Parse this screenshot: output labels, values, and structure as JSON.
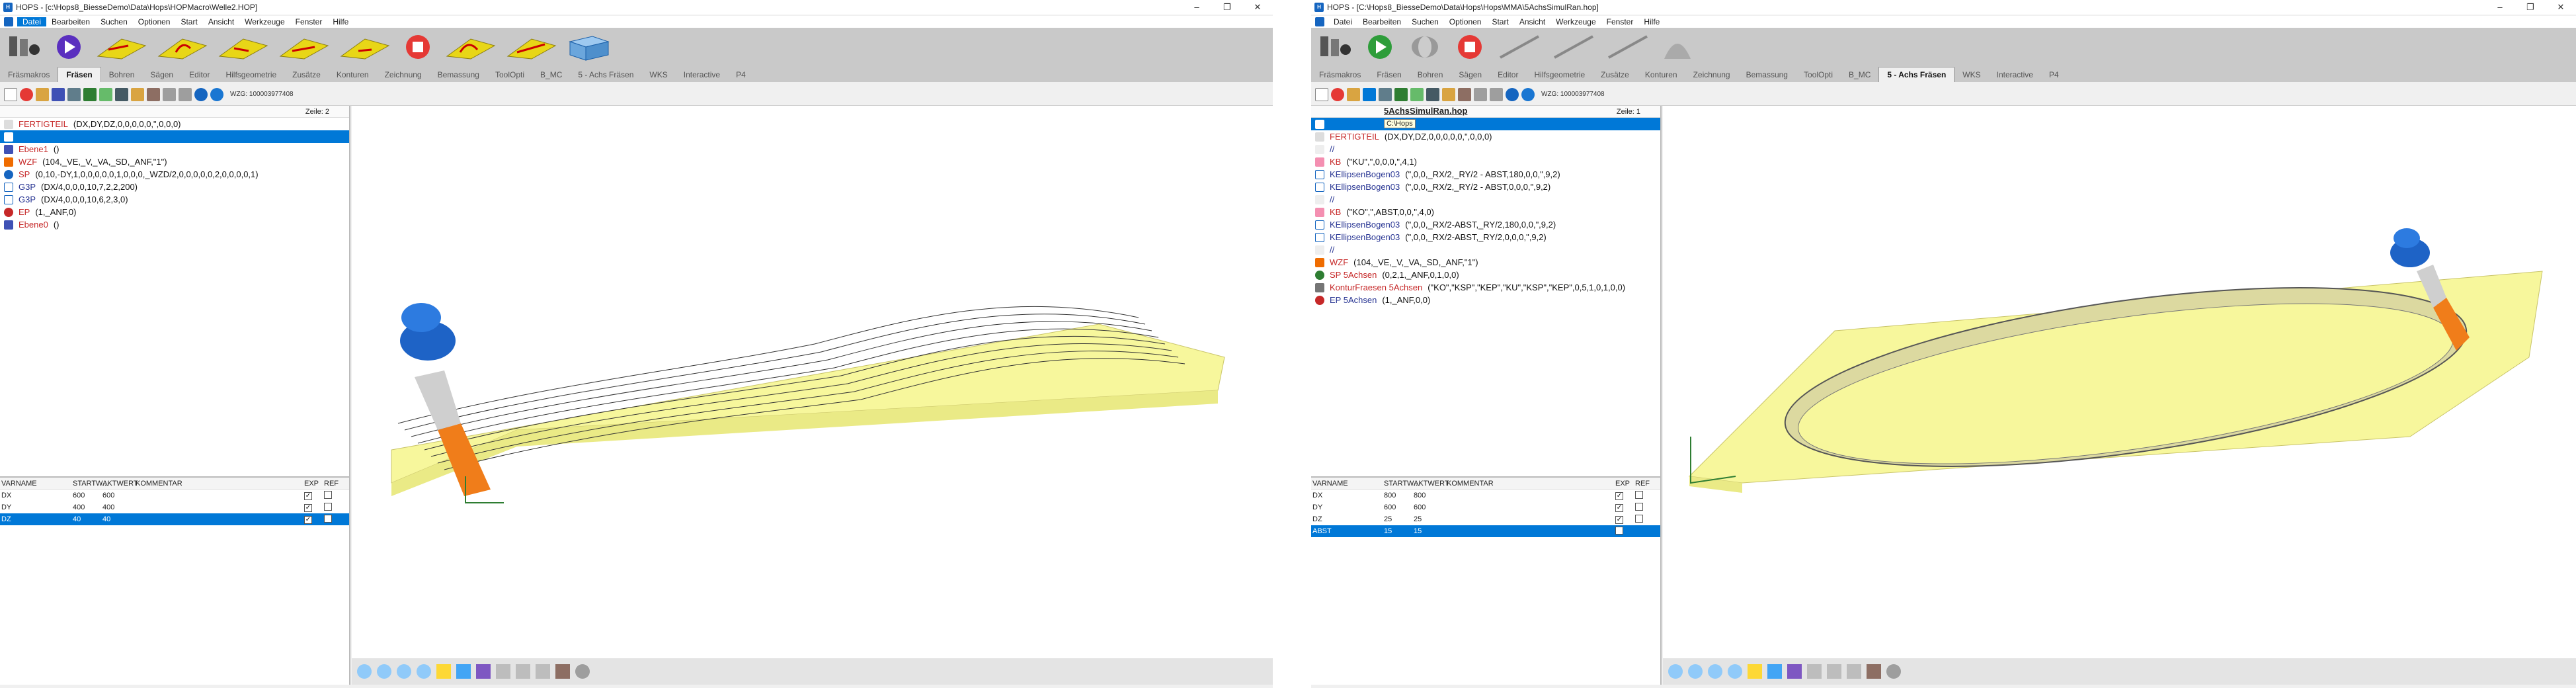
{
  "left": {
    "title": "HOPS - [c:\\Hops8_BiesseDemo\\Data\\Hops\\HOPMacro\\Welle2.HOP]",
    "menu": [
      "Datei",
      "Bearbeiten",
      "Suchen",
      "Optionen",
      "Start",
      "Ansicht",
      "Werkzeuge",
      "Fenster",
      "Hilfe"
    ],
    "tabs": [
      "Fräsmakros",
      "Fräsen",
      "Bohren",
      "Sägen",
      "Editor",
      "Hilfsgeometrie",
      "Zusätze",
      "Konturen",
      "Zeichnung",
      "Bemassung",
      "ToolOpti",
      "B_MC",
      "5 - Achs Fräsen",
      "WKS",
      "Interactive",
      "P4"
    ],
    "active_tab": "Fräsen",
    "wzg": "WZG: 100003977408",
    "zeile": "Zeile: 2",
    "program": [
      {
        "kw": "FERTIGTEIL",
        "args": "(DX,DY,DZ,0,0,0,0,0,\",0,0,0)"
      },
      {
        "kw": "",
        "args": ""
      },
      {
        "kw": "Ebene1",
        "args": "()"
      },
      {
        "kw": "WZF",
        "args": "(104,_VE,_V,_VA,_SD,_ANF,\"1\")"
      },
      {
        "kw": "SP",
        "args": "(0,10,-DY,1,0,0,0,0,0,1,0,0,0,_WZD/2,0,0,0,0,0,2,0,0,0,0,1)"
      },
      {
        "kw": "G3P",
        "args": "(DX/4,0,0,0,10,7,2,2,200)"
      },
      {
        "kw": "G3P",
        "args": "(DX/4,0,0,0,10,6,2,3,0)"
      },
      {
        "kw": "EP",
        "args": "(1,_ANF,0)"
      },
      {
        "kw": "Ebene0",
        "args": "()"
      }
    ],
    "vars_header": [
      "VARNAME",
      "STARTW...",
      "AKTWERT",
      "KOMMENTAR",
      "EXP",
      "REF"
    ],
    "vars": [
      {
        "name": "DX",
        "start": "600",
        "akt": "600",
        "exp": true,
        "ref": false
      },
      {
        "name": "DY",
        "start": "400",
        "akt": "400",
        "exp": true,
        "ref": false
      },
      {
        "name": "DZ",
        "start": "40",
        "akt": "40",
        "exp": true,
        "ref": false
      }
    ]
  },
  "right": {
    "title": "HOPS - [C:\\Hops8_BiesseDemo\\Data\\Hops\\Hops\\MMA\\5AchsSimulRan.hop]",
    "menu": [
      "Datei",
      "Bearbeiten",
      "Suchen",
      "Optionen",
      "Start",
      "Ansicht",
      "Werkzeuge",
      "Fenster",
      "Hilfe"
    ],
    "tabs": [
      "Fräsmakros",
      "Fräsen",
      "Bohren",
      "Sägen",
      "Editor",
      "Hilfsgeometrie",
      "Zusätze",
      "Konturen",
      "Zeichnung",
      "Bemassung",
      "ToolOpti",
      "B_MC",
      "5 - Achs Fräsen",
      "WKS",
      "Interactive",
      "P4"
    ],
    "active_tab": "5 - Achs Fräsen",
    "wzg": "WZG: 100003977408",
    "filename": "5AchsSimulRan.hop",
    "tooltip": "C:\\Hops",
    "zeile": "Zeile: 1",
    "program": [
      {
        "kw": "",
        "args": ""
      },
      {
        "kw": "FERTIGTEIL",
        "args": "(DX,DY,DZ,0,0,0,0,0,\",0,0,0)"
      },
      {
        "kw": "//",
        "args": ""
      },
      {
        "kw": "KB",
        "args": "(\"KU\",\",0,0,0,\",4,1)"
      },
      {
        "kw": "KEllipsenBogen03",
        "args": "(\",0,0,_RX/2,_RY/2 - ABST,180,0,0,\",9,2)"
      },
      {
        "kw": "KEllipsenBogen03",
        "args": "(\",0,0,_RX/2,_RY/2 - ABST,0,0,0,\",9,2)"
      },
      {
        "kw": "//",
        "args": ""
      },
      {
        "kw": "KB",
        "args": "(\"KO\",\",ABST,0,0,\",4,0)"
      },
      {
        "kw": "KEllipsenBogen03",
        "args": "(\",0,0,_RX/2-ABST,_RY/2,180,0,0,\",9,2)"
      },
      {
        "kw": "KEllipsenBogen03",
        "args": "(\",0,0,_RX/2-ABST,_RY/2,0,0,0,\",9,2)"
      },
      {
        "kw": "//",
        "args": ""
      },
      {
        "kw": "WZF",
        "args": "(104,_VE,_V,_VA,_SD,_ANF,\"1\")"
      },
      {
        "kw": "SP 5Achsen",
        "args": "(0,2,1,_ANF,0,1,0,0)"
      },
      {
        "kw": "KonturFraesen 5Achsen",
        "args": "(\"KO\",\"KSP\",\"KEP\",\"KU\",\"KSP\",\"KEP\",0,5,1,0,1,0,0)"
      },
      {
        "kw": "EP 5Achsen",
        "args": "(1,_ANF,0,0)"
      }
    ],
    "vars_header": [
      "VARNAME",
      "STARTW...",
      "AKTWERT",
      "KOMMENTAR",
      "EXP",
      "REF"
    ],
    "vars": [
      {
        "name": "DX",
        "start": "800",
        "akt": "800",
        "exp": true,
        "ref": false
      },
      {
        "name": "DY",
        "start": "600",
        "akt": "600",
        "exp": true,
        "ref": false
      },
      {
        "name": "DZ",
        "start": "25",
        "akt": "25",
        "exp": true,
        "ref": false
      },
      {
        "name": "ABST",
        "start": "15",
        "akt": "15",
        "exp": false,
        "ref": false
      }
    ]
  },
  "colors": {
    "accent": "#0078d7",
    "ribbon": "#c9c9c9",
    "board": "#f7f79c",
    "tool_blue": "#1e63c6",
    "tool_orange": "#f07d1a"
  }
}
